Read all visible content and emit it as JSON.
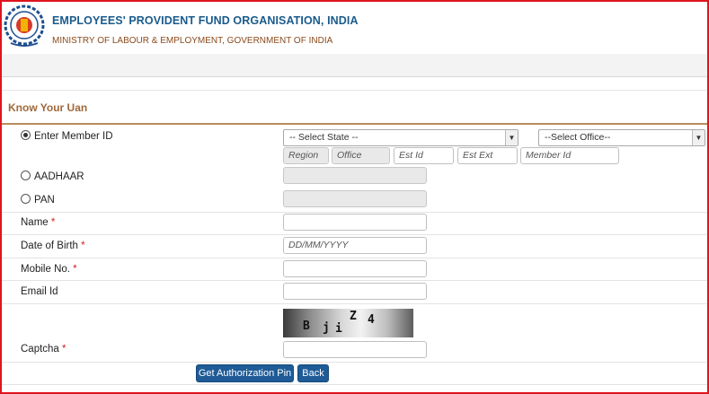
{
  "header": {
    "org_name": "EMPLOYEES' PROVIDENT FUND ORGANISATION, INDIA",
    "ministry": "MINISTRY OF LABOUR & EMPLOYMENT, GOVERNMENT OF INDIA"
  },
  "section": {
    "title": "Know Your Uan"
  },
  "form": {
    "member_id_label": "Enter Member ID",
    "state_select": "-- Select State --",
    "office_select": "--Select Office--",
    "region_placeholder": "Region",
    "office_placeholder": "Office",
    "est_id_placeholder": "Est Id",
    "est_ext_placeholder": "Est Ext",
    "member_id_placeholder": "Member Id",
    "aadhaar_label": "AADHAAR",
    "pan_label": "PAN",
    "name_label": "Name",
    "dob_label": "Date of Birth",
    "dob_placeholder": "DD/MM/YYYY",
    "mobile_label": "Mobile No.",
    "email_label": "Email Id",
    "captcha_label": "Captcha",
    "required_mark": "*",
    "captcha_chars": [
      "B",
      "j",
      "i",
      "Z",
      "4"
    ]
  },
  "buttons": {
    "get_pin": "Get Authorization Pin",
    "back": "Back"
  },
  "colors": {
    "brand_blue": "#1e5b97",
    "section_brown": "#a0683a",
    "frame_red": "#e0141e"
  }
}
